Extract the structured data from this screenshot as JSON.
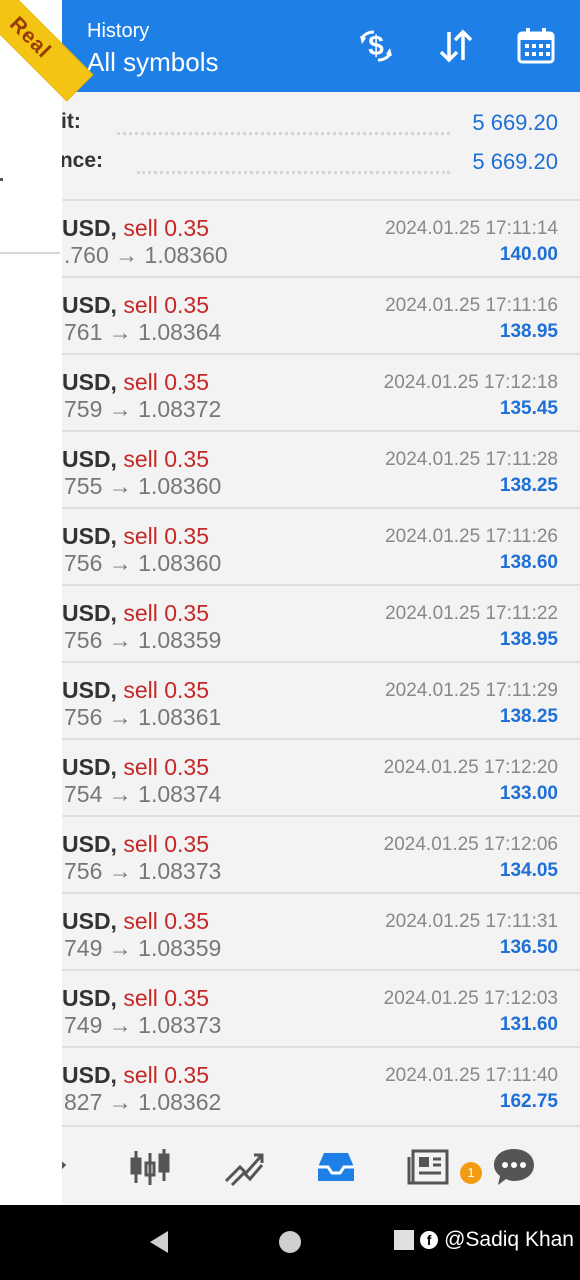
{
  "ribbon": {
    "label": "Real"
  },
  "header": {
    "subtitle": "History",
    "title": "All symbols"
  },
  "summary": {
    "profit_label": "fit:",
    "profit_value": "5 669.20",
    "balance_label": "ınce:",
    "balance_value": "5 669.20"
  },
  "trades": [
    {
      "symbol": "USD, ",
      "side": "sell 0.35",
      "prices": ".760 → 1.08360",
      "time": "2024.01.25 17:11:14",
      "profit": "140.00"
    },
    {
      "symbol": "USD, ",
      "side": "sell 0.35",
      "prices": "761 → 1.08364",
      "time": "2024.01.25 17:11:16",
      "profit": "138.95"
    },
    {
      "symbol": "USD, ",
      "side": "sell 0.35",
      "prices": "759 → 1.08372",
      "time": "2024.01.25 17:12:18",
      "profit": "135.45"
    },
    {
      "symbol": "USD, ",
      "side": "sell 0.35",
      "prices": "755 → 1.08360",
      "time": "2024.01.25 17:11:28",
      "profit": "138.25"
    },
    {
      "symbol": "USD, ",
      "side": "sell 0.35",
      "prices": "756 → 1.08360",
      "time": "2024.01.25 17:11:26",
      "profit": "138.60"
    },
    {
      "symbol": "USD, ",
      "side": "sell 0.35",
      "prices": "756 → 1.08359",
      "time": "2024.01.25 17:11:22",
      "profit": "138.95"
    },
    {
      "symbol": "USD, ",
      "side": "sell 0.35",
      "prices": "756 → 1.08361",
      "time": "2024.01.25 17:11:29",
      "profit": "138.25"
    },
    {
      "symbol": "USD, ",
      "side": "sell 0.35",
      "prices": "754 → 1.08374",
      "time": "2024.01.25 17:12:20",
      "profit": "133.00"
    },
    {
      "symbol": "USD, ",
      "side": "sell 0.35",
      "prices": "756 → 1.08373",
      "time": "2024.01.25 17:12:06",
      "profit": "134.05"
    },
    {
      "symbol": "USD, ",
      "side": "sell 0.35",
      "prices": "749 → 1.08359",
      "time": "2024.01.25 17:11:31",
      "profit": "136.50"
    },
    {
      "symbol": "USD, ",
      "side": "sell 0.35",
      "prices": "749 → 1.08373",
      "time": "2024.01.25 17:12:03",
      "profit": "131.60"
    },
    {
      "symbol": "USD, ",
      "side": "sell 0.35",
      "prices": "827 → 1.08362",
      "time": "2024.01.25 17:11:40",
      "profit": "162.75"
    }
  ],
  "nav": {
    "items": [
      "quotes-icon",
      "chart-candles-icon",
      "trade-icon",
      "history-inbox-icon",
      "news-icon",
      "chat-icon"
    ],
    "active": "history-inbox-icon",
    "chat_badge": "1"
  },
  "header_icons": [
    "deposit-dollar-icon",
    "sort-icon",
    "calendar-icon"
  ],
  "watermark": {
    "text": "@Sadiq Khan",
    "logo": "f"
  },
  "colors": {
    "header": "#1e7fe6",
    "sell": "#c62828",
    "profit": "#1e6fd6",
    "badge": "#f39c12",
    "ribbon": "#f3c414"
  }
}
